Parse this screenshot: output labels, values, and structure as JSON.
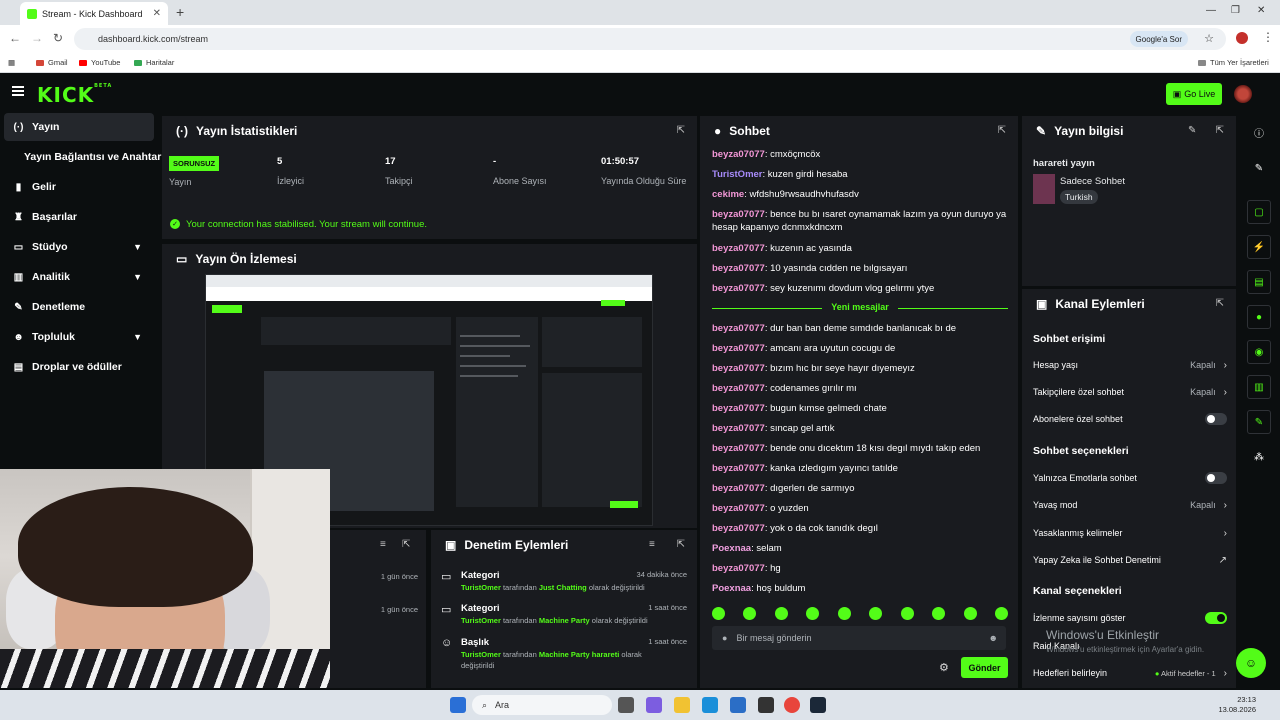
{
  "browser": {
    "tab_title": "Stream - Kick Dashboard",
    "url": "dashboard.kick.com/stream",
    "google_sor": "Google'a Sor",
    "bookmarks": [
      "Gmail",
      "YouTube",
      "Haritalar"
    ],
    "all_bookmarks": "Tüm Yer İşaretleri"
  },
  "header": {
    "logo": "KICK",
    "beta": "BETA",
    "go_live": "Go Live"
  },
  "sidebar": {
    "items": [
      {
        "label": "Yayın",
        "icon": "broadcast-icon"
      },
      {
        "label": "Yayın Bağlantısı ve Anahtarı",
        "icon": ""
      },
      {
        "label": "Gelir",
        "icon": "chart-icon"
      },
      {
        "label": "Başarılar",
        "icon": "trophy-icon"
      },
      {
        "label": "Stüdyo",
        "icon": "studio-icon"
      },
      {
        "label": "Analitik",
        "icon": "analytics-icon"
      },
      {
        "label": "Denetleme",
        "icon": "wrench-icon"
      },
      {
        "label": "Topluluk",
        "icon": "community-icon"
      },
      {
        "label": "Droplar ve ödüller",
        "icon": "gift-icon"
      }
    ]
  },
  "stats": {
    "title": "Yayın İstatistikleri",
    "badge": "SORUNSUZ",
    "items": [
      {
        "value": "",
        "label": "Yayın"
      },
      {
        "value": "5",
        "label": "İzleyici"
      },
      {
        "value": "17",
        "label": "Takipçi"
      },
      {
        "value": "-",
        "label": "Abone Sayısı"
      },
      {
        "value": "01:50:57",
        "label": "Yayında Olduğu Süre"
      }
    ],
    "connection": "Your connection has stabilised. Your stream will continue."
  },
  "preview": {
    "title": "Yayın Ön İzlemesi"
  },
  "moderation": {
    "title": "Denetim Eylemleri",
    "left_times": [
      "1 gün önce",
      "1 gün önce"
    ],
    "rows": [
      {
        "title": "Kategori",
        "time": "34 dakika önce",
        "user": "TuristOmer",
        "mid": " tarafından ",
        "value": "Just Chatting",
        "tail": " olarak değiştirildi"
      },
      {
        "title": "Kategori",
        "time": "1 saat önce",
        "user": "TuristOmer",
        "mid": " tarafından ",
        "value": "Machine Party",
        "tail": " olarak değiştirildi"
      },
      {
        "title": "Başlık",
        "time": "1 saat önce",
        "user": "TuristOmer",
        "mid": " tarafından ",
        "value": "Machine Party harareti",
        "tail": " olarak değiştirildi"
      }
    ]
  },
  "chat": {
    "title": "Sohbet",
    "messages": [
      {
        "user": "beyza07077",
        "text": "cmxöçmcöx",
        "color": "#f297d6"
      },
      {
        "user": "TuristOmer",
        "text": "kuzen girdi hesaba",
        "color": "#a78bfa"
      },
      {
        "user": "cekime",
        "text": "wfdshu9rwsaudhvhufasdv",
        "color": "#f297d6"
      },
      {
        "user": "beyza07077",
        "text": "bence bu bı ısaret oynamamak lazım ya oyun duruyo ya hesap kapanıyo dcnmxkdncxm",
        "color": "#f297d6"
      },
      {
        "user": "beyza07077",
        "text": "kuzenın ac yasında",
        "color": "#f297d6"
      },
      {
        "user": "beyza07077",
        "text": "10 yasında cıdden ne bılgısayarı",
        "color": "#f297d6"
      },
      {
        "user": "beyza07077",
        "text": "sey kuzenımı dovdum vlog gelırmı ytye",
        "color": "#f297d6"
      },
      {
        "user": "beyza07077",
        "text": "dur ban ban deme sımdıde banlanıcak bı de",
        "color": "#f297d6"
      },
      {
        "user": "beyza07077",
        "text": "amcanı ara uyutun cocugu de",
        "color": "#f297d6"
      },
      {
        "user": "beyza07077",
        "text": "bızım hıc bır seye hayır dıyemeyız",
        "color": "#f297d6"
      },
      {
        "user": "beyza07077",
        "text": "codenames gırılır mı",
        "color": "#f297d6"
      },
      {
        "user": "beyza07077",
        "text": "bugun kımse gelmedı chate",
        "color": "#f297d6"
      },
      {
        "user": "beyza07077",
        "text": "sıncap gel artık",
        "color": "#f297d6"
      },
      {
        "user": "beyza07077",
        "text": "bende onu dıcektım 18 kısı degıl mıydı takıp eden",
        "color": "#f297d6"
      },
      {
        "user": "beyza07077",
        "text": "kanka ızledıgım yayıncı tatılde",
        "color": "#f297d6"
      },
      {
        "user": "beyza07077",
        "text": "dıgerlerı de sarmıyo",
        "color": "#f297d6"
      },
      {
        "user": "beyza07077",
        "text": "o yuzden",
        "color": "#f297d6"
      },
      {
        "user": "beyza07077",
        "text": "yok o da cok tanıdık degıl",
        "color": "#f297d6"
      },
      {
        "user": "Poexnaa",
        "text": "selam",
        "color": "#f0a0e0"
      },
      {
        "user": "beyza07077",
        "text": "hg",
        "color": "#f297d6"
      },
      {
        "user": "Poexnaa",
        "text": "hoş buldum",
        "color": "#f0a0e0"
      }
    ],
    "new_messages": "Yeni mesajlar",
    "placeholder": "Bir mesaj gönderin",
    "send": "Gönder"
  },
  "info": {
    "title": "Yayın bilgisi",
    "stream_title": "harareti yayın",
    "category": "Sadece Sohbet",
    "tag": "Turkish"
  },
  "channel": {
    "title": "Kanal Eylemleri",
    "sec1": "Sohbet erişimi",
    "hesap": "Hesap yaşı",
    "hesap_val": "Kapalı",
    "takipci": "Takipçilere özel sohbet",
    "takipci_val": "Kapalı",
    "abone": "Abonelere özel sohbet",
    "sec2": "Sohbet seçenekleri",
    "emote": "Yalnızca Emotlarla sohbet",
    "yavas": "Yavaş mod",
    "yavas_val": "Kapalı",
    "yasak": "Yasaklanmış kelimeler",
    "yapay": "Yapay Zeka ile Sohbet Denetimi",
    "sec3": "Kanal seçenekleri",
    "izlenme": "İzlenme sayısını göster",
    "raid": "Raid Kanalı",
    "hedef": "Hedefleri belirleyin",
    "hedef_val": "Aktif hedefler - 1"
  },
  "windows": {
    "activate": "Windows'u Etkinleştir",
    "activate_sub": "Windows'u etkinleştirmek için Ayarlar'a gidin.",
    "search": "Ara",
    "time": "23:13",
    "date": "13.08.2026"
  },
  "colors": {
    "accent": "#53fc18",
    "panel": "#191b1f",
    "bg": "#0b0e0f"
  }
}
